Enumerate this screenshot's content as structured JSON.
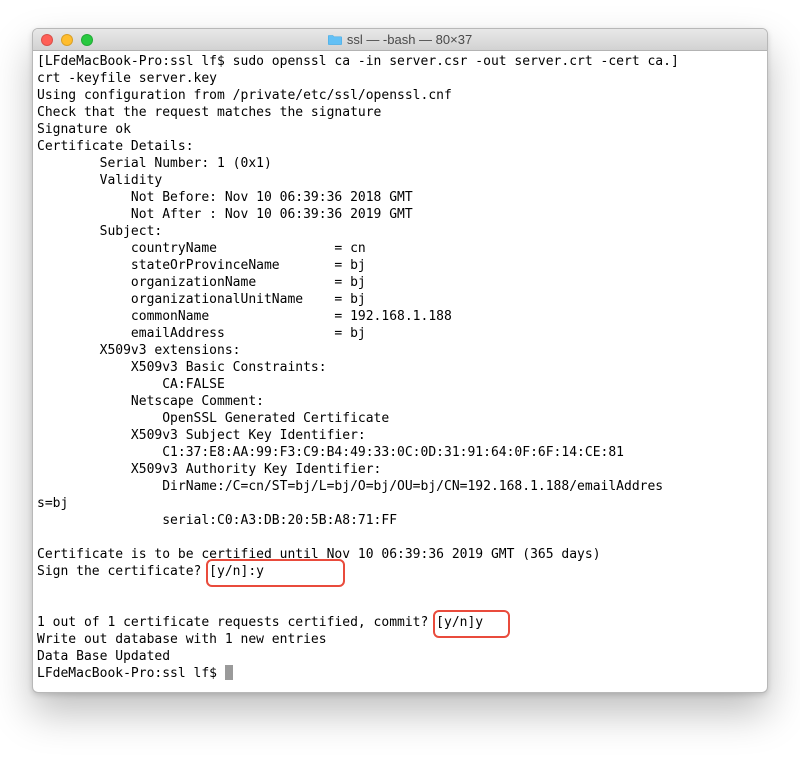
{
  "window": {
    "title": "ssl — -bash — 80×37"
  },
  "terminal": {
    "lines": [
      "[LFdeMacBook-Pro:ssl lf$ sudo openssl ca -in server.csr -out server.crt -cert ca.]",
      "crt -keyfile server.key",
      "Using configuration from /private/etc/ssl/openssl.cnf",
      "Check that the request matches the signature",
      "Signature ok",
      "Certificate Details:",
      "        Serial Number: 1 (0x1)",
      "        Validity",
      "            Not Before: Nov 10 06:39:36 2018 GMT",
      "            Not After : Nov 10 06:39:36 2019 GMT",
      "        Subject:",
      "            countryName               = cn",
      "            stateOrProvinceName       = bj",
      "            organizationName          = bj",
      "            organizationalUnitName    = bj",
      "            commonName                = 192.168.1.188",
      "            emailAddress              = bj",
      "        X509v3 extensions:",
      "            X509v3 Basic Constraints: ",
      "                CA:FALSE",
      "            Netscape Comment: ",
      "                OpenSSL Generated Certificate",
      "            X509v3 Subject Key Identifier: ",
      "                C1:37:E8:AA:99:F3:C9:B4:49:33:0C:0D:31:91:64:0F:6F:14:CE:81",
      "            X509v3 Authority Key Identifier: ",
      "                DirName:/C=cn/ST=bj/L=bj/O=bj/OU=bj/CN=192.168.1.188/emailAddres",
      "s=bj",
      "                serial:C0:A3:DB:20:5B:A8:71:FF",
      "",
      "Certificate is to be certified until Nov 10 06:39:36 2019 GMT (365 days)",
      "Sign the certificate? [y/n]:y",
      "",
      "",
      "1 out of 1 certificate requests certified, commit? [y/n]y",
      "Write out database with 1 new entries",
      "Data Base Updated",
      "LFdeMacBook-Pro:ssl lf$ "
    ],
    "prompt_cursor_line_index": 36
  },
  "highlights": [
    {
      "top_line": 30,
      "left_ch": 22,
      "width_ch": 17,
      "height_lines": 1.4
    },
    {
      "top_line": 33,
      "left_ch": 51,
      "width_ch": 9,
      "height_lines": 1.4
    }
  ]
}
